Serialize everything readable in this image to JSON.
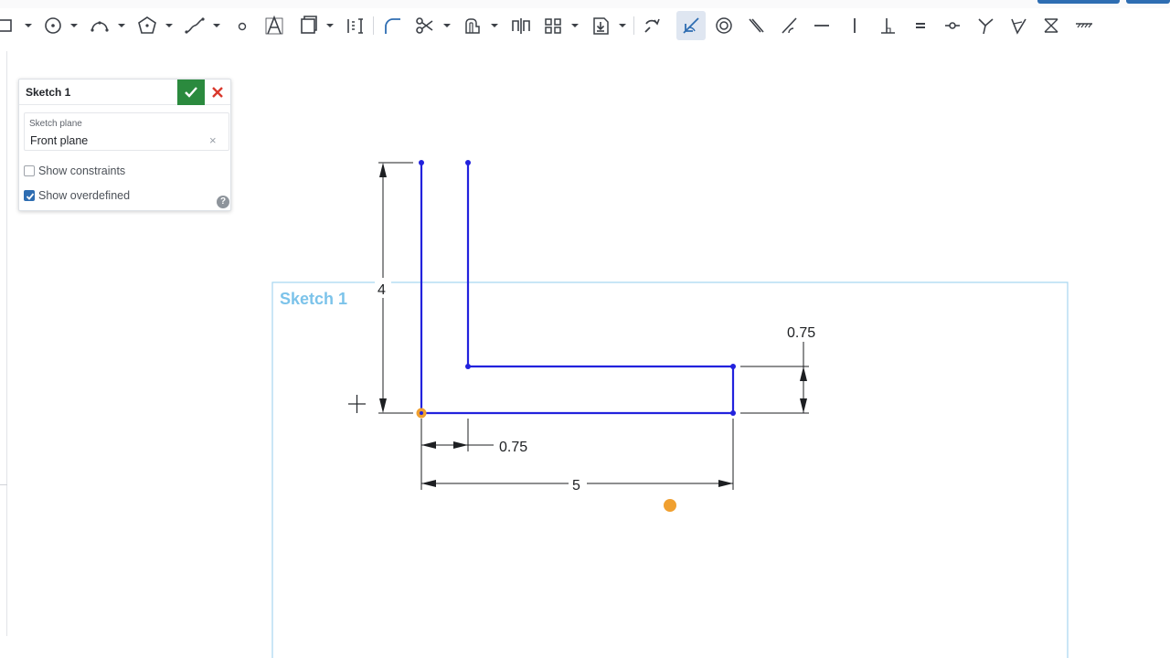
{
  "toolbar": {
    "tools": [
      {
        "name": "rectangle-tool",
        "caret": true
      },
      {
        "name": "circle-tool",
        "caret": true
      },
      {
        "name": "arc-tool",
        "caret": true
      },
      {
        "name": "polygon-tool",
        "caret": true
      },
      {
        "name": "spline-tool",
        "caret": true
      },
      {
        "name": "point-tool",
        "caret": false
      },
      {
        "name": "text-tool",
        "caret": false
      },
      {
        "name": "construction-tool",
        "caret": true
      },
      {
        "name": "use-tool",
        "caret": false
      },
      {
        "name": "fillet-tool",
        "caret": false
      },
      {
        "name": "trim-tool",
        "caret": true
      },
      {
        "name": "offset-tool",
        "caret": true
      },
      {
        "name": "mirror-tool",
        "caret": false
      },
      {
        "name": "pattern-tool",
        "caret": true
      },
      {
        "name": "insert-tool",
        "caret": true
      },
      {
        "name": "transform-tool",
        "caret": false
      },
      {
        "name": "dimension-tool",
        "caret": false,
        "active": true
      },
      {
        "name": "concentric-constraint",
        "caret": false
      },
      {
        "name": "parallel-constraint",
        "caret": false
      },
      {
        "name": "tangent-constraint",
        "caret": false
      },
      {
        "name": "horizontal-constraint",
        "caret": false
      },
      {
        "name": "vertical-constraint",
        "caret": false
      },
      {
        "name": "perpendicular-constraint",
        "caret": false
      },
      {
        "name": "equal-constraint",
        "caret": false
      },
      {
        "name": "midpoint-constraint",
        "caret": false
      },
      {
        "name": "normal-constraint",
        "caret": false
      },
      {
        "name": "pierce-constraint",
        "caret": false
      },
      {
        "name": "symmetric-constraint",
        "caret": false
      },
      {
        "name": "fix-constraint",
        "caret": false
      }
    ]
  },
  "dialog": {
    "title": "Sketch 1",
    "plane_label": "Sketch plane",
    "plane_value": "Front plane",
    "plane_clear": "×",
    "show_constraints_label": "Show constraints",
    "show_constraints_checked": false,
    "show_overdefined_label": "Show overdefined",
    "show_overdefined_checked": true,
    "help_glyph": "?"
  },
  "canvas": {
    "plane_label": "Sketch 1",
    "dimensions": {
      "height": "4",
      "wall_thickness": "0.75",
      "base_length": "5",
      "base_thickness": "0.75"
    },
    "colors": {
      "sketch_line": "#2222dd",
      "origin": "#f0a030",
      "plane_border": "#a8d6f0",
      "plane_label": "#7cc3ea",
      "active_tool": "#dfe6f1"
    }
  }
}
